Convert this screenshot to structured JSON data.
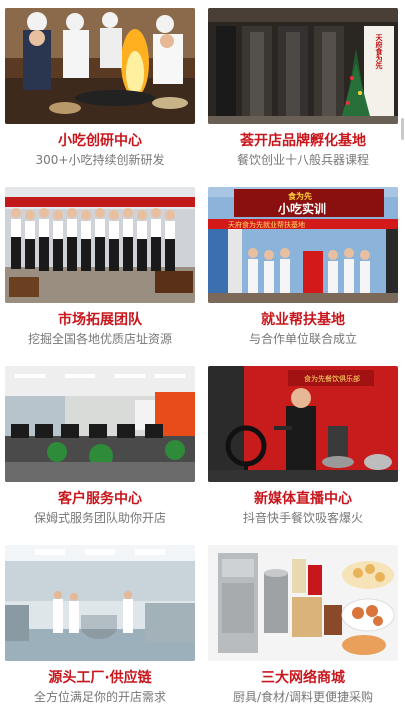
{
  "cards": [
    {
      "title": "小吃创研中心",
      "subtitle": "300+小吃持续创新研发"
    },
    {
      "title": "荟开店品牌孵化基地",
      "subtitle": "餐饮创业十八般兵器课程"
    },
    {
      "title": "市场拓展团队",
      "subtitle": "挖掘全国各地优质店址资源"
    },
    {
      "title": "就业帮扶基地",
      "subtitle": "与合作单位联合成立"
    },
    {
      "title": "客户服务中心",
      "subtitle": "保姆式服务团队助你开店"
    },
    {
      "title": "新媒体直播中心",
      "subtitle": "抖音快手餐饮吸客爆火"
    },
    {
      "title": "源头工厂·供应链",
      "subtitle": "全方位满足你的开店需求"
    },
    {
      "title": "三大网络商城",
      "subtitle": "厨具/食材/调料更便捷采购"
    }
  ],
  "signs": {
    "store_sign": "天府食为先",
    "banner_top": "食为先",
    "banner_main": "小吃实训",
    "banner_red": "天府食为先就业帮扶基地",
    "studio_sign": "食为先餐饮俱乐部"
  },
  "colors": {
    "title": "#c8161d",
    "subtitle": "#777777"
  }
}
